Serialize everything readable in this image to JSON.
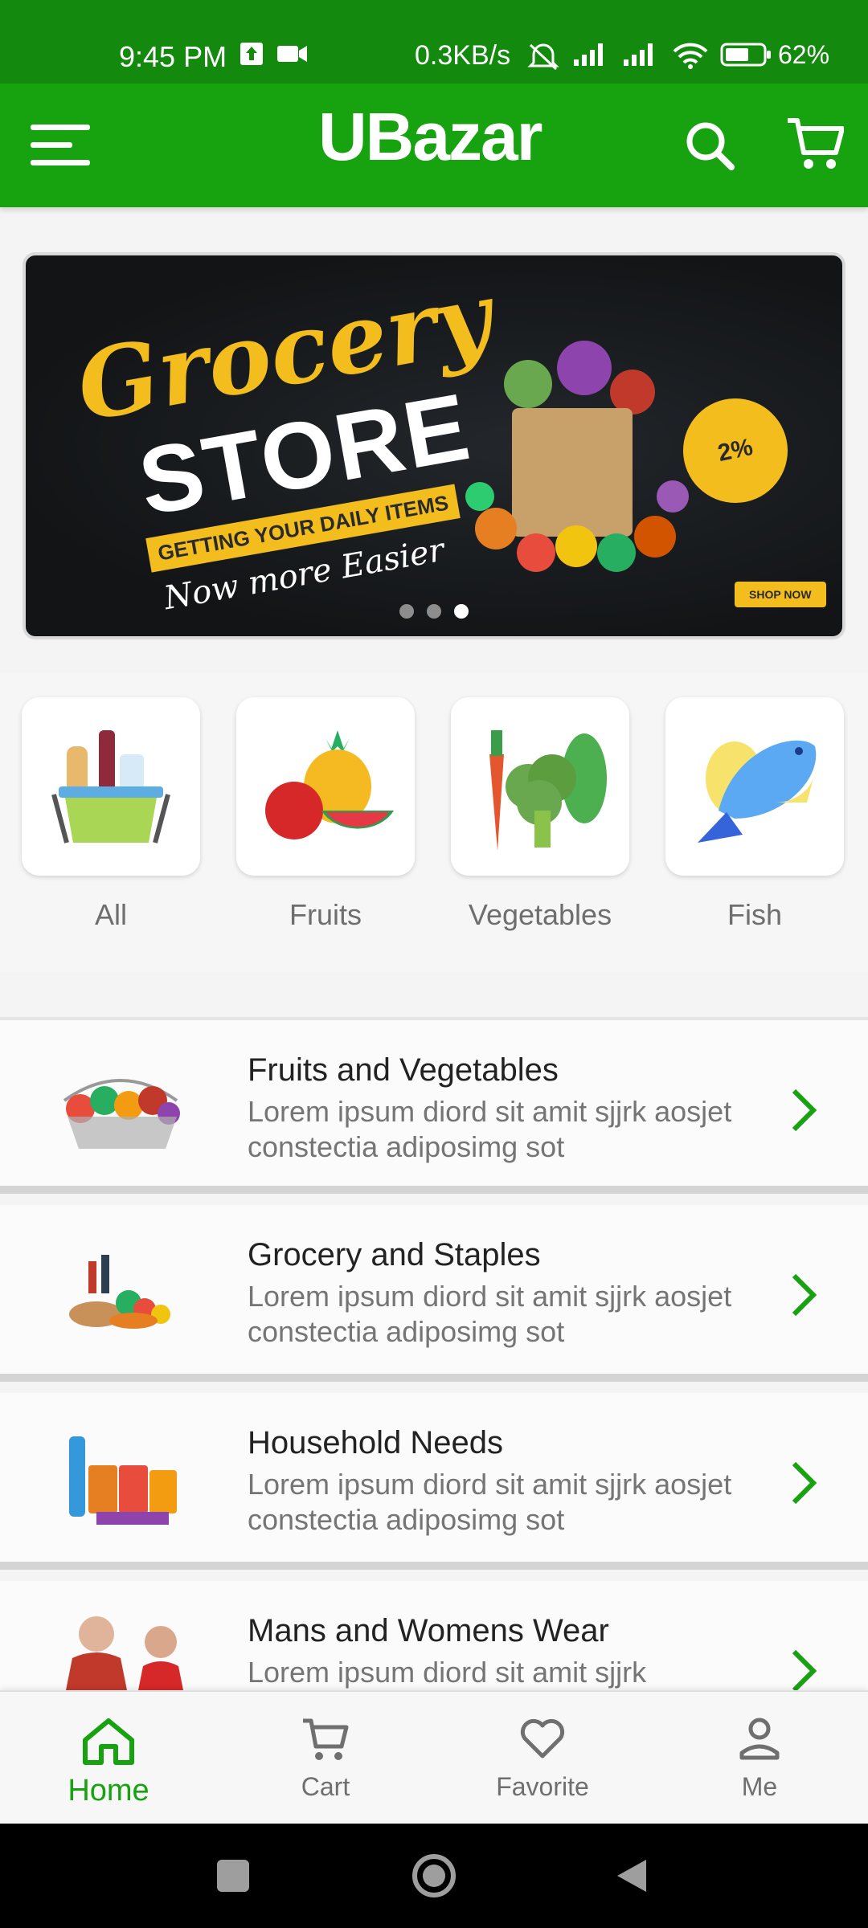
{
  "status_bar": {
    "time": "9:45 PM",
    "network_speed": "0.3KB/s",
    "battery": "62%"
  },
  "app_bar": {
    "logo": "UBazar",
    "icons": [
      "menu-icon",
      "search-icon",
      "cart-icon"
    ]
  },
  "banner": {
    "title": "Grocery",
    "subtitle": "STORE",
    "tagline": "GETTING YOUR DAILY ITEMS",
    "script_text": "Now more Easier",
    "badge": "2%",
    "shop_button": "SHOP NOW",
    "slides_count": 3,
    "active_slide": 3
  },
  "categories": [
    {
      "label": "All",
      "icon": "basket-icon"
    },
    {
      "label": "Fruits",
      "icon": "fruits-icon"
    },
    {
      "label": "Vegetables",
      "icon": "vegetables-icon"
    },
    {
      "label": "Fish",
      "icon": "fish-icon"
    }
  ],
  "list": [
    {
      "title": "Fruits and Vegetables",
      "desc": "Lorem ipsum diord sit amit sjjrk aosjet constectia adiposimg sot"
    },
    {
      "title": "Grocery and Staples",
      "desc": "Lorem ipsum diord sit amit sjjrk aosjet constectia adiposimg sot"
    },
    {
      "title": "Household Needs",
      "desc": "Lorem ipsum diord sit amit sjjrk aosjet constectia adiposimg sot"
    },
    {
      "title": "Mans and Womens Wear",
      "desc": "Lorem ipsum diord sit amit sjjrk"
    }
  ],
  "bottom_nav": [
    {
      "label": "Home",
      "icon": "home-icon",
      "active": true
    },
    {
      "label": "Cart",
      "icon": "cart-icon",
      "active": false
    },
    {
      "label": "Favorite",
      "icon": "heart-icon",
      "active": false
    },
    {
      "label": "Me",
      "icon": "person-icon",
      "active": false
    }
  ],
  "colors": {
    "primary_green": "#17a20f",
    "status_green": "#138a0e",
    "banner_yellow": "#f4bd1e",
    "text_gray": "#757575"
  }
}
